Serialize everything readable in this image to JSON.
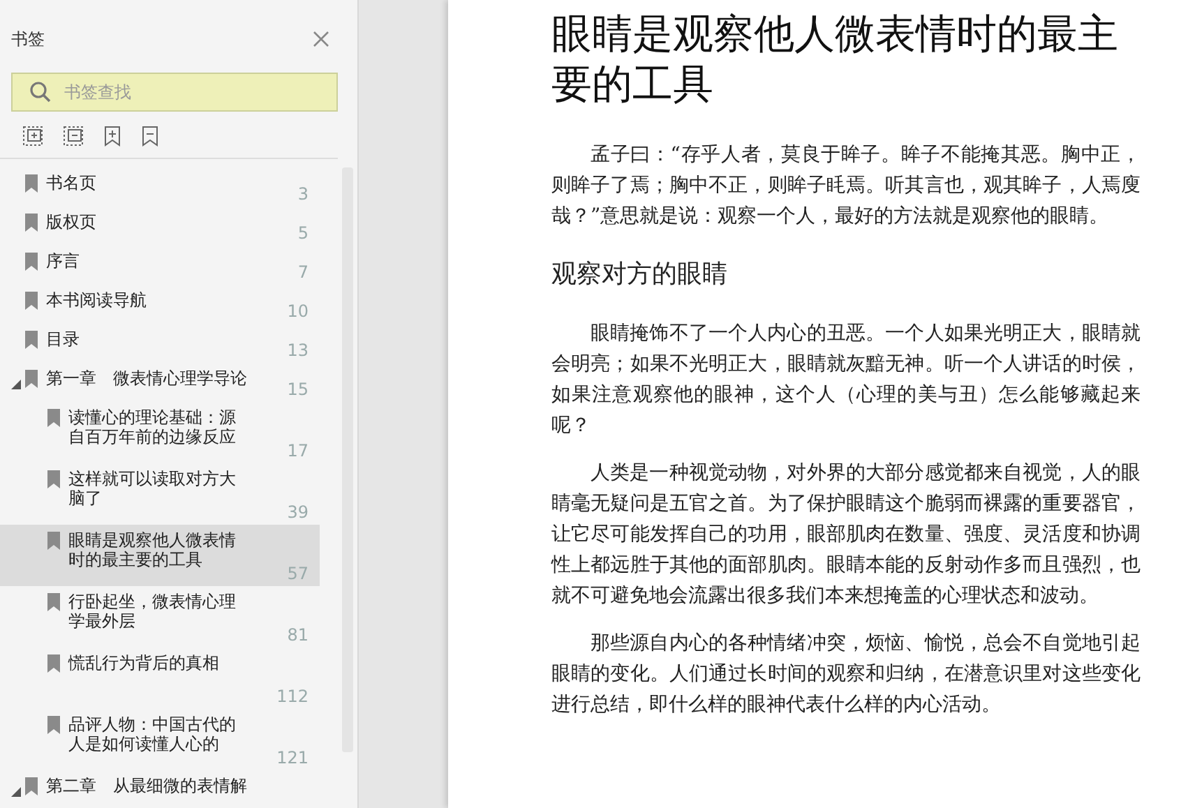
{
  "sidebar": {
    "title": "书签",
    "search": {
      "placeholder": "书签查找"
    },
    "bookmarks": [
      {
        "label": "书名页",
        "page": "3",
        "selected": false
      },
      {
        "label": "版权页",
        "page": "5",
        "selected": false
      },
      {
        "label": "序言",
        "page": "7",
        "selected": false
      },
      {
        "label": "本书阅读导航",
        "page": "10",
        "selected": false
      },
      {
        "label": "目录",
        "page": "13",
        "selected": false
      },
      {
        "label": "第一章　微表情心理学导论",
        "page": "15",
        "selected": false,
        "expanded": true,
        "children": [
          {
            "label": "读懂心的理论基础：源自百万年前的边缘反应",
            "page": "17",
            "selected": false
          },
          {
            "label": "这样就可以读取对方大脑了",
            "page": "39",
            "selected": false
          },
          {
            "label": "眼睛是观察他人微表情时的最主要的工具",
            "page": "57",
            "selected": true
          },
          {
            "label": "行卧起坐，微表情心理学最外层",
            "page": "81",
            "selected": false
          },
          {
            "label": "慌乱行为背后的真相",
            "page": "112",
            "selected": false
          },
          {
            "label": "品评人物：中国古代的人是如何读懂人心的",
            "page": "121",
            "selected": false
          }
        ]
      },
      {
        "label": "第二章　从最细微的表情解",
        "selected": false,
        "expanded": true
      }
    ]
  },
  "document": {
    "title": "眼睛是观察他人微表情时的最主要的工具",
    "blocks": [
      {
        "kind": "quote",
        "text": "孟子曰：“存乎人者，莫良于眸子。眸子不能掩其恶。胸中正，则眸子了焉；胸中不正，则眸子眊焉。听其言也，观其眸子，人焉廋哉？”意思就是说：观察一个人，最好的方法就是观察他的眼睛。"
      },
      {
        "kind": "heading",
        "text": "观察对方的眼睛"
      },
      {
        "kind": "body",
        "text": "眼睛掩饰不了一个人内心的丑恶。一个人如果光明正大，眼睛就会明亮；如果不光明正大，眼睛就灰黯无神。听一个人讲话的时侯，如果注意观察他的眼神，这个人（心理的美与丑）怎么能够藏起来呢？"
      },
      {
        "kind": "body",
        "text": "人类是一种视觉动物，对外界的大部分感觉都来自视觉，人的眼睛毫无疑问是五官之首。为了保护眼睛这个脆弱而裸露的重要器官，让它尽可能发挥自己的功用，眼部肌肉在数量、强度、灵活度和协调性上都远胜于其他的面部肌肉。眼睛本能的反射动作多而且强烈，也就不可避免地会流露出很多我们本来想掩盖的心理状态和波动。"
      },
      {
        "kind": "body",
        "text": "那些源自内心的各种情绪冲突，烦恼、愉悦，总会不自觉地引起眼睛的变化。人们通过长时间的观察和归纳，在潜意识里对这些变化进行总结，即什么样的眼神代表什么样的内心活动。"
      }
    ]
  }
}
